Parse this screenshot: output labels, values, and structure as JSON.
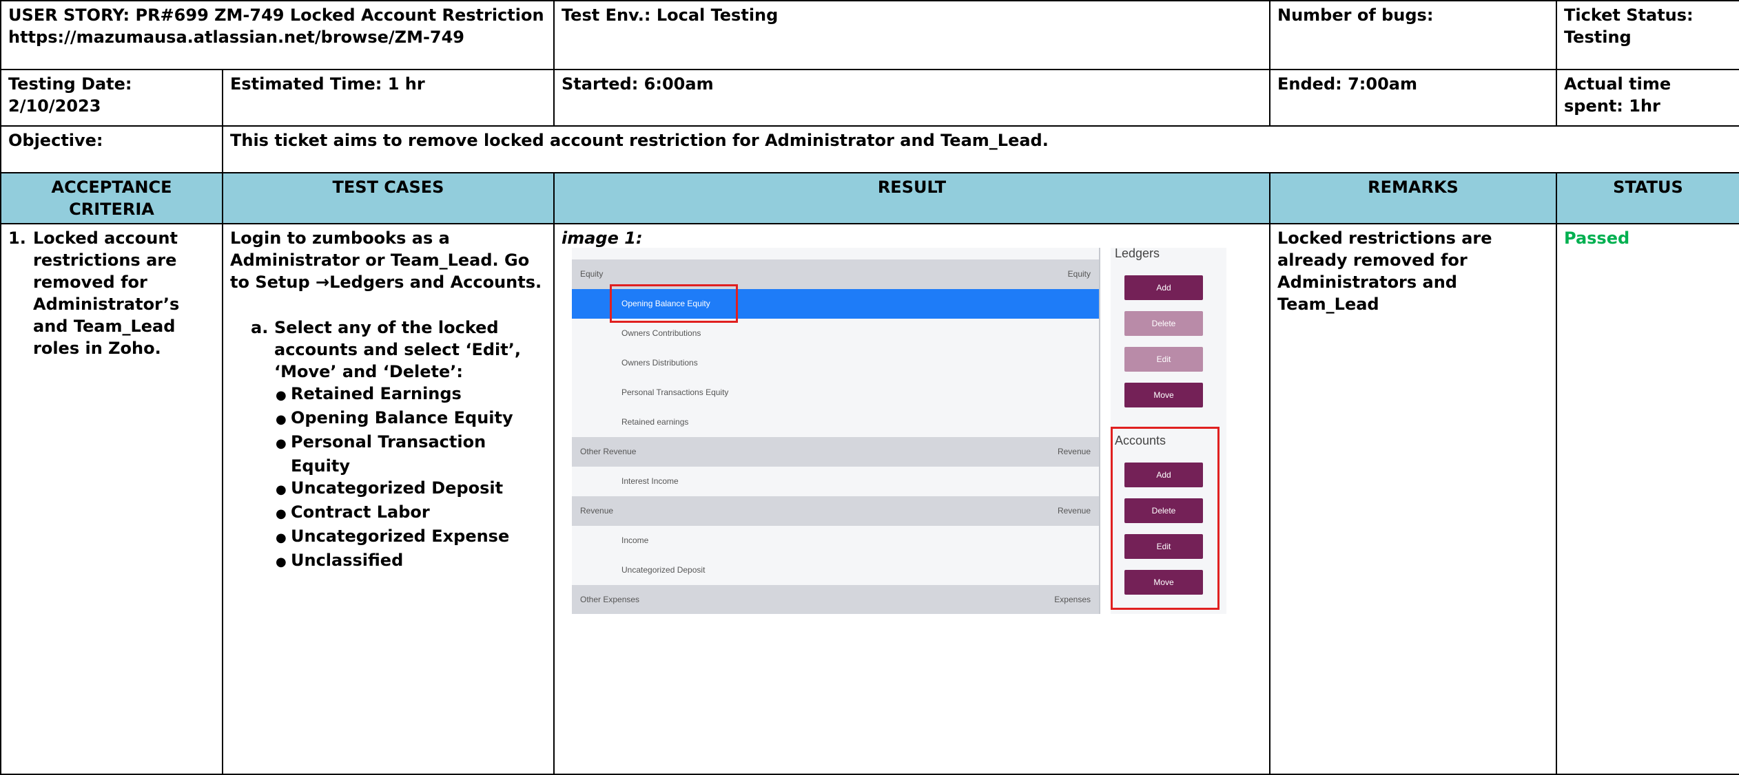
{
  "header": {
    "user_story_label": "USER STORY: ",
    "user_story_id": "PR#699",
    "user_story_title": " ZM-749 Locked Account Restriction",
    "user_story_url": "https://mazumausa.atlassian.net/browse/ZM-749",
    "test_env": "Test Env.: Local Testing",
    "number_of_bugs": "Number of bugs:",
    "ticket_status": "Ticket Status: Testing",
    "testing_date": "Testing Date:   2/10/2023",
    "estimated_time": "Estimated Time: 1 hr",
    "started": "Started:  6:00am",
    "ended": "Ended: 7:00am",
    "actual_time": "Actual time spent: 1hr",
    "objective_label": "Objective:",
    "objective_text": "This ticket aims to remove locked account restriction for Administrator and Team_Lead."
  },
  "columns": {
    "acceptance": "ACCEPTANCE CRITERIA",
    "test_cases": "TEST CASES",
    "result": "RESULT",
    "remarks": "REMARKS",
    "status": "STATUS"
  },
  "row": {
    "criteria_num": "1.",
    "criteria_text": "Locked account restrictions are removed for Administrator’s and Team_Lead roles in Zoho.",
    "test_intro": "Login to zumbooks as a Administrator or Team_Lead. Go to Setup →Ledgers and Accounts.",
    "sub_letter": "a.",
    "sub_text": "Select any of the locked accounts and select ‘Edit’, ‘Move’ and ‘Delete’:",
    "accounts": [
      "Retained Earnings",
      "Opening Balance Equity",
      "Personal Transaction Equity",
      "Uncategorized Deposit",
      "Contract Labor",
      "Uncategorized Expense",
      "Unclassified"
    ],
    "result_label": "image 1:",
    "remarks": "Locked restrictions are already removed for Administrators and Team_Lead",
    "status": "Passed"
  },
  "screenshot": {
    "groups": [
      {
        "name": "Equity",
        "type": "Equity"
      },
      {
        "name": "Other Revenue",
        "type": "Revenue"
      },
      {
        "name": "Revenue",
        "type": "Revenue"
      },
      {
        "name": "Other Expenses",
        "type": "Expenses"
      }
    ],
    "items": [
      "Opening Balance Equity",
      "Owners Contributions",
      "Owners Distributions",
      "Personal Transactions Equity",
      "Retained earnings",
      "Interest Income",
      "Income",
      "Uncategorized Deposit"
    ],
    "ledgers_title": "Ledgers",
    "accounts_title": "Accounts",
    "btn_add": "Add",
    "btn_delete": "Delete",
    "btn_edit": "Edit",
    "btn_move": "Move",
    "colors": {
      "selected": "#1e7cf8",
      "button": "#742157",
      "button_disabled": "#b98ba8",
      "highlight": "#e02020",
      "passed": "#00b050",
      "header_bg": "#92cddc"
    }
  }
}
